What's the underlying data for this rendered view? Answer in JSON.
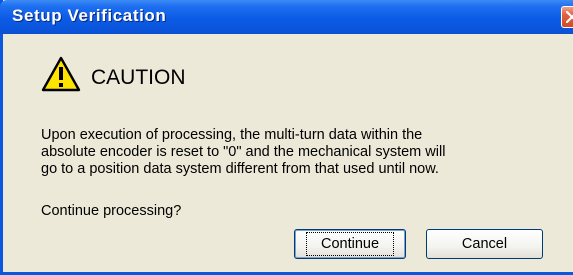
{
  "window": {
    "title": "Setup Verification"
  },
  "caution": {
    "icon": "warning-triangle-icon",
    "label": "CAUTION"
  },
  "message": {
    "lines": [
      "Upon execution of processing, the multi-turn data within the",
      "absolute encoder is reset to \"0\" and the mechanical system will",
      "go to a position data system different from that used until now."
    ],
    "prompt": "Continue processing?"
  },
  "buttons": {
    "continue_label": "Continue",
    "cancel_label": "Cancel"
  },
  "colors": {
    "titlebar": "#0c5be6",
    "dialog_background": "#ece9d8",
    "warning_yellow": "#ffe300",
    "close_button": "#d34a26"
  }
}
